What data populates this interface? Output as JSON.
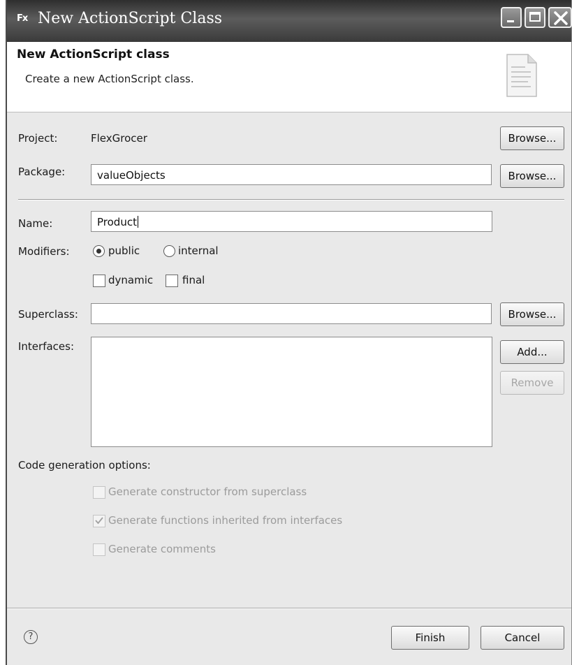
{
  "window": {
    "icon_label": "Fx",
    "title": "New ActionScript Class"
  },
  "header": {
    "title": "New ActionScript class",
    "description": "Create a new ActionScript class."
  },
  "form": {
    "project_label": "Project:",
    "project_value": "FlexGrocer",
    "package_label": "Package:",
    "package_value": "valueObjects",
    "name_label": "Name:",
    "name_value": "Product",
    "modifiers_label": "Modifiers:",
    "modifiers": {
      "public_label": "public",
      "internal_label": "internal",
      "selected": "public",
      "dynamic_label": "dynamic",
      "dynamic_checked": false,
      "final_label": "final",
      "final_checked": false
    },
    "superclass_label": "Superclass:",
    "superclass_value": "",
    "interfaces_label": "Interfaces:",
    "interfaces": []
  },
  "buttons": {
    "browse_label": "Browse...",
    "add_label": "Add...",
    "remove_label": "Remove",
    "finish_label": "Finish",
    "cancel_label": "Cancel"
  },
  "codegen": {
    "section_label": "Code generation options:",
    "options": [
      {
        "label": "Generate constructor from superclass",
        "checked": false,
        "enabled": false
      },
      {
        "label": "Generate functions inherited from interfaces",
        "checked": true,
        "enabled": false
      },
      {
        "label": "Generate comments",
        "checked": false,
        "enabled": false
      }
    ]
  },
  "help": {
    "glyph": "?"
  },
  "icons": [
    "fx-app-icon",
    "minimize-icon",
    "maximize-icon",
    "close-icon",
    "document-icon",
    "help-icon"
  ]
}
